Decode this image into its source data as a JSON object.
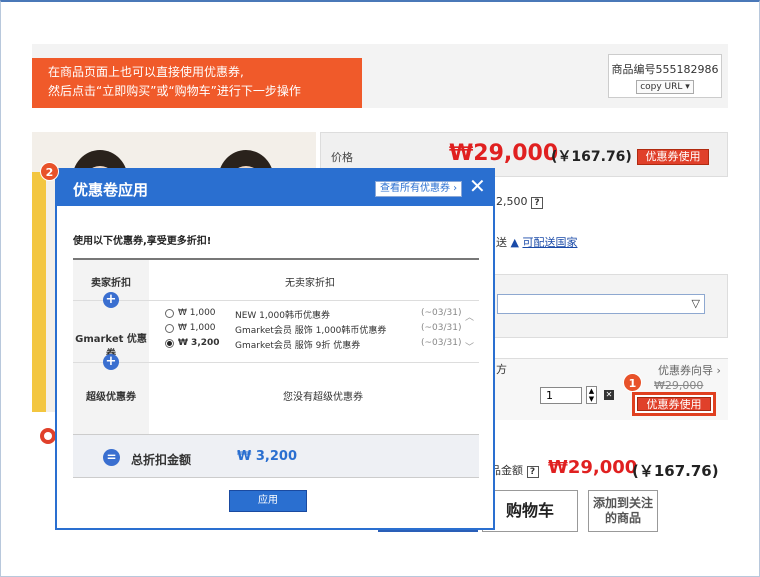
{
  "banner": {
    "line1": "在商品页面上也可以直接使用优惠券,",
    "line2": "然后点击“立即购买”或“购物车”进行下一步操作"
  },
  "product_no": {
    "label": "商品编号555182986",
    "copy_url": "copy URL ▾"
  },
  "price": {
    "label": "价格",
    "krw": "₩29,000",
    "cny": "(￥167.76)",
    "coupon_btn": "优惠券使用"
  },
  "info": {
    "fragment_price": "2,500",
    "ship_prefix": "送",
    "ship_link": "可配送国家"
  },
  "qty": {
    "partial_label": "方",
    "guide": "优惠券向导 ›",
    "strike_price": "₩29,000",
    "value": "1",
    "coupon_btn": "优惠券使用"
  },
  "total": {
    "label": "品金额",
    "krw": "₩29,000",
    "cny": "(￥167.76)"
  },
  "buttons": {
    "cart": "购物车",
    "wishlist": "添加到关注的商品"
  },
  "badges": {
    "one": "1",
    "two": "2"
  },
  "popup": {
    "title": "优惠卷应用",
    "view_all": "查看所有优惠券 ›",
    "desc": "使用以下优惠券,享受更多折扣!",
    "rows": {
      "seller_label": "卖家折扣",
      "seller_value": "无卖家折扣",
      "gmarket_label": "Gmarket 优惠券",
      "super_label": "超级优惠券",
      "super_value": "您没有超级优惠券"
    },
    "coupons": [
      {
        "amount": "₩ 1,000",
        "name": "NEW 1,000韩币优惠券",
        "expiry": "(~03/31)",
        "selected": false
      },
      {
        "amount": "₩ 1,000",
        "name": "Gmarket会员  服饰  1,000韩币优惠券",
        "expiry": "(~03/31)",
        "selected": false
      },
      {
        "amount": "₩ 3,200",
        "name": "Gmarket会员  服饰  9折  优惠券",
        "expiry": "(~03/31)",
        "selected": true
      }
    ],
    "sum_label": "总折扣金额",
    "sum_value": "₩ 3,200",
    "apply_btn": "应用"
  },
  "colors": {
    "accent": "#2a6fd0",
    "price_red": "#e02020",
    "banner": "#f05a2a",
    "coupon_btn": "#e0402a"
  }
}
